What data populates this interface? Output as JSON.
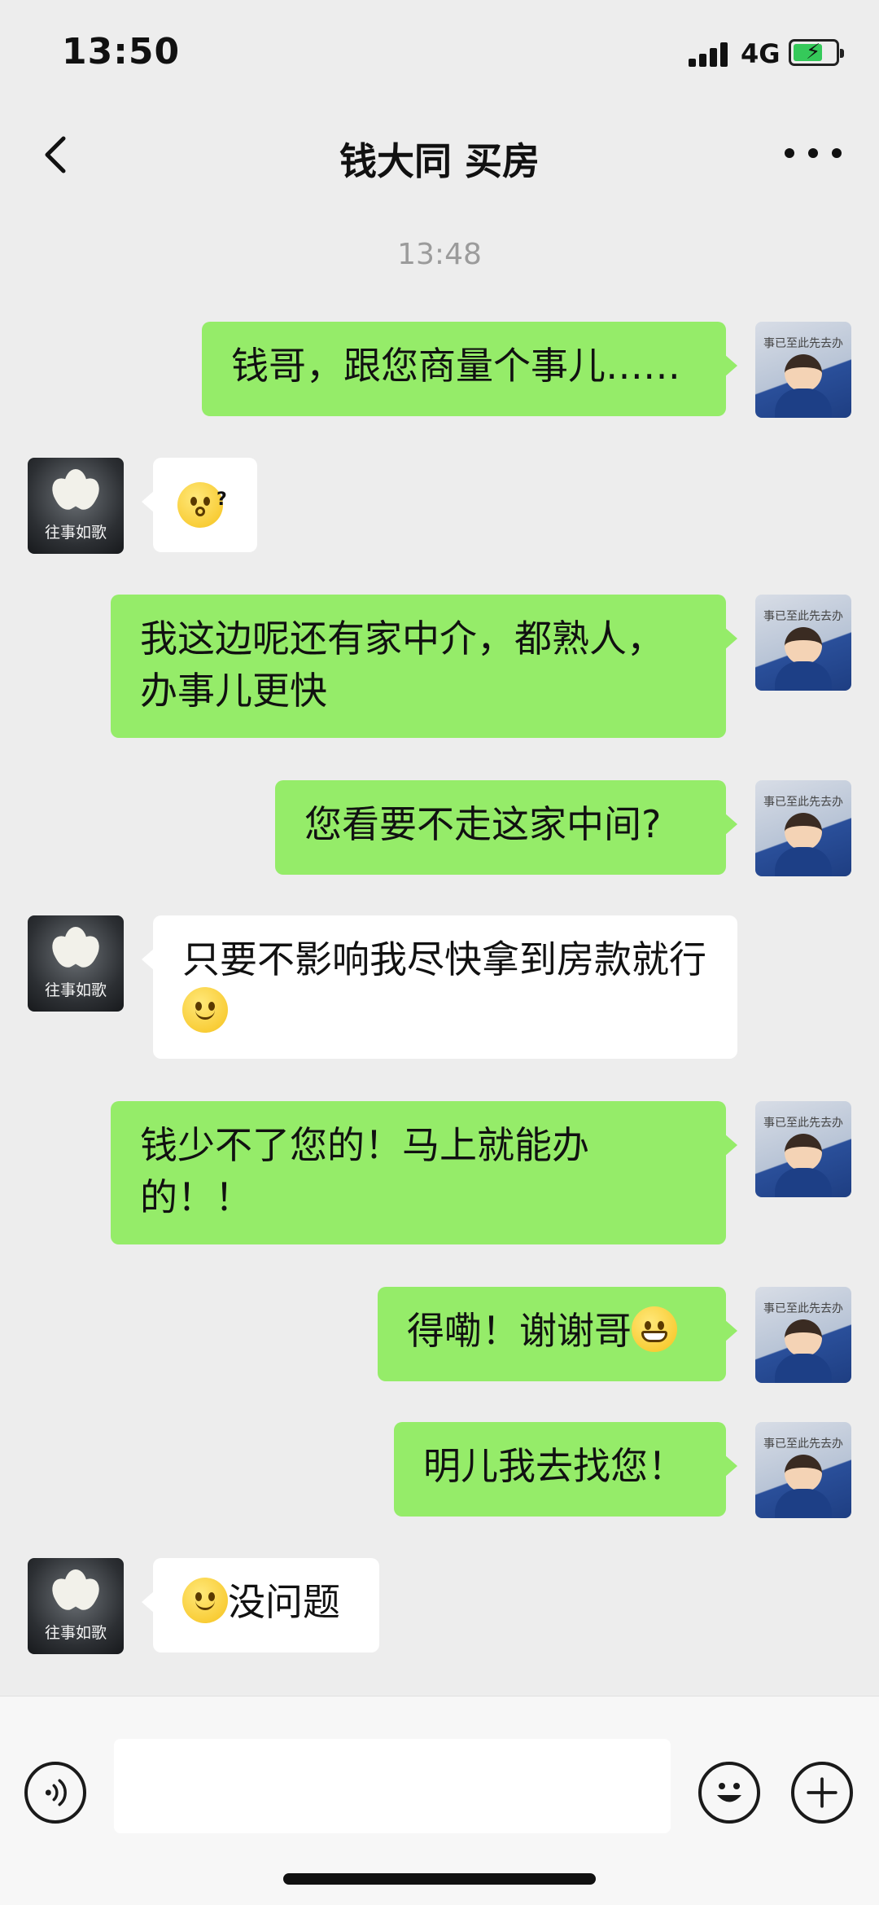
{
  "status_bar": {
    "time": "13:50",
    "network": "4G",
    "battery_level": 0.7,
    "battery_charging": true
  },
  "nav": {
    "title": "钱大同 买房",
    "back_icon": "chevron-left-icon",
    "more_icon": "more-dots-icon"
  },
  "chat": {
    "timestamp": "13:48",
    "messages": [
      {
        "side": "out",
        "text": "钱哥，跟您商量个事儿……"
      },
      {
        "side": "in",
        "text": "",
        "emoji": "thinking-question-emoji"
      },
      {
        "side": "out",
        "text": "我这边呢还有家中介，都熟人，办事儿更快"
      },
      {
        "side": "out",
        "text": "您看要不走这家中间?"
      },
      {
        "side": "in",
        "text": "只要不影响我尽快拿到房款就行",
        "emoji": "smile-emoji"
      },
      {
        "side": "out",
        "text": "钱少不了您的！马上就能办的！！"
      },
      {
        "side": "out",
        "text": "得嘞！谢谢哥",
        "emoji": "grin-emoji"
      },
      {
        "side": "out",
        "text": "明儿我去找您！"
      },
      {
        "side": "in",
        "text": "没问题",
        "emoji": "smile-emoji"
      }
    ],
    "me_avatar_caption": "事已至此先去办",
    "other_avatar_caption": "往事如歌"
  },
  "input_bar": {
    "voice_icon": "voice-icon",
    "emoji_icon": "emoji-icon",
    "plus_icon": "plus-icon",
    "input_value": ""
  },
  "colors": {
    "background": "#EDEDED",
    "outgoing_bubble": "#95EC69",
    "incoming_bubble": "#FFFFFF",
    "timestamp": "#9B9B9B"
  }
}
